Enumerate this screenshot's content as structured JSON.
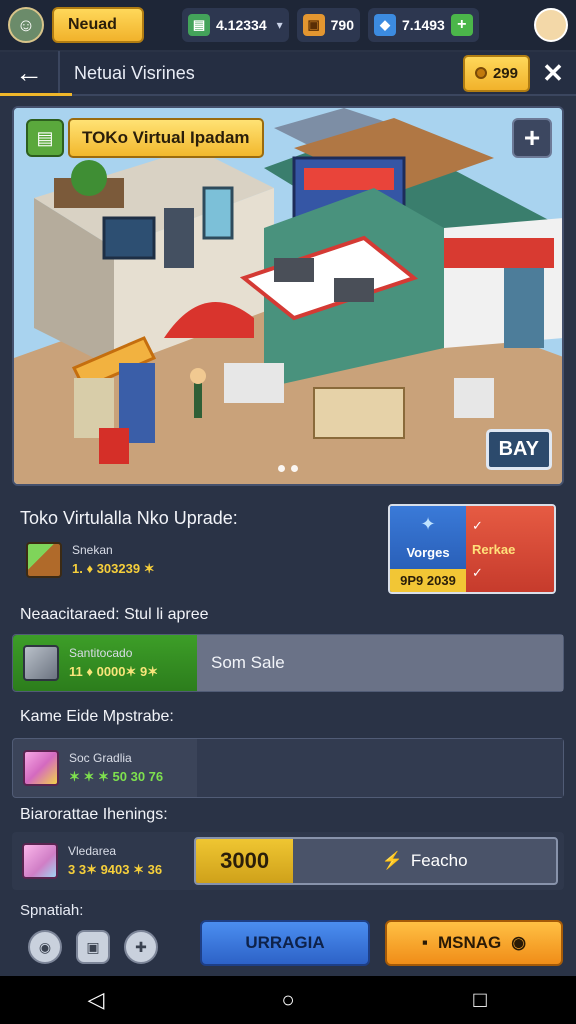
{
  "topbar": {
    "player_name": "Neuad",
    "cash": "4.12334",
    "crates": "790",
    "gems": "7.1493"
  },
  "header": {
    "title": "Netuai Visrines",
    "coins": "299"
  },
  "scene": {
    "store_name": "TOKo Virtual Ipadam",
    "buy_sign": "BAY"
  },
  "upgrade": {
    "title": "Toko Virtulalla Nko Uprade:",
    "item_name": "Snekan",
    "item_value": "1. ♦ 303239 ✶",
    "card_blue_label": "Vorges",
    "card_blue_price": "9P9 2039",
    "card_red_label": "Rerkae"
  },
  "section2": {
    "title": "Neaacitaraed: Stul li apree",
    "item_name": "Santitocado",
    "item_value": "11 ♦ 0000✶ 9✶",
    "action": "Som Sale"
  },
  "section3": {
    "title": "Kame Eide Mpstrabe:",
    "item_name": "Soc Gradlia",
    "item_value": "✶ ✶ ✶ 50 30 76"
  },
  "section4": {
    "title": "Biarorattae Ihenings:",
    "item_name": "Vledarea",
    "item_value": "3 3✶ 9403 ✶ 36",
    "progress_value": "3000",
    "progress_fraction": 0.27,
    "progress_label": "Feacho"
  },
  "bottom": {
    "label": "Spnatiah:",
    "btn_upgrade": "URRAGIA",
    "btn_manage": "MSNAG"
  },
  "colors": {
    "accent": "#f2b82d",
    "background": "#2a3346",
    "primary_button": "#2d62c7",
    "secondary_button": "#f08d18",
    "success": "#3d9e28"
  }
}
